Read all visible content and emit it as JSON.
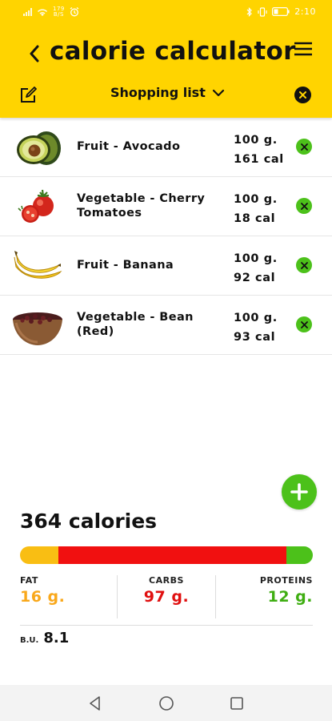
{
  "status_bar": {
    "time": "2:10",
    "data_rate_top": "179",
    "data_rate_unit": "B/S",
    "battery": "23"
  },
  "header": {
    "title": "calorie calculator",
    "list_selector_label": "Shopping list"
  },
  "foods": [
    {
      "name": "Fruit - Avocado",
      "amount": "100 g.",
      "calories": "161 cal",
      "image": "avocado-image"
    },
    {
      "name": "Vegetable - Cherry Tomatoes",
      "amount": "100 g.",
      "calories": "18 cal",
      "image": "tomato-image"
    },
    {
      "name": "Fruit - Banana",
      "amount": "100 g.",
      "calories": "92 cal",
      "image": "banana-image"
    },
    {
      "name": "Vegetable - Bean (Red)",
      "amount": "100 g.",
      "calories": "93 cal",
      "image": "beans-image"
    }
  ],
  "summary": {
    "total_label": "364 calories",
    "fat_label": "FAT",
    "fat_value": "16 g.",
    "carbs_label": "CARBS",
    "carbs_value": "97 g.",
    "proteins_label": "PROTEINS",
    "proteins_value": "12 g.",
    "bu_label": "B.U.",
    "bu_value": "8.1",
    "bar_share": {
      "fat": 0.13,
      "carbs": 0.78,
      "protein": 0.09
    }
  },
  "colors": {
    "brand_yellow": "#ffd400",
    "accent_green": "#4cc11a",
    "fat": "#f9be13",
    "carbs": "#f11010",
    "protein": "#4cc11a"
  }
}
